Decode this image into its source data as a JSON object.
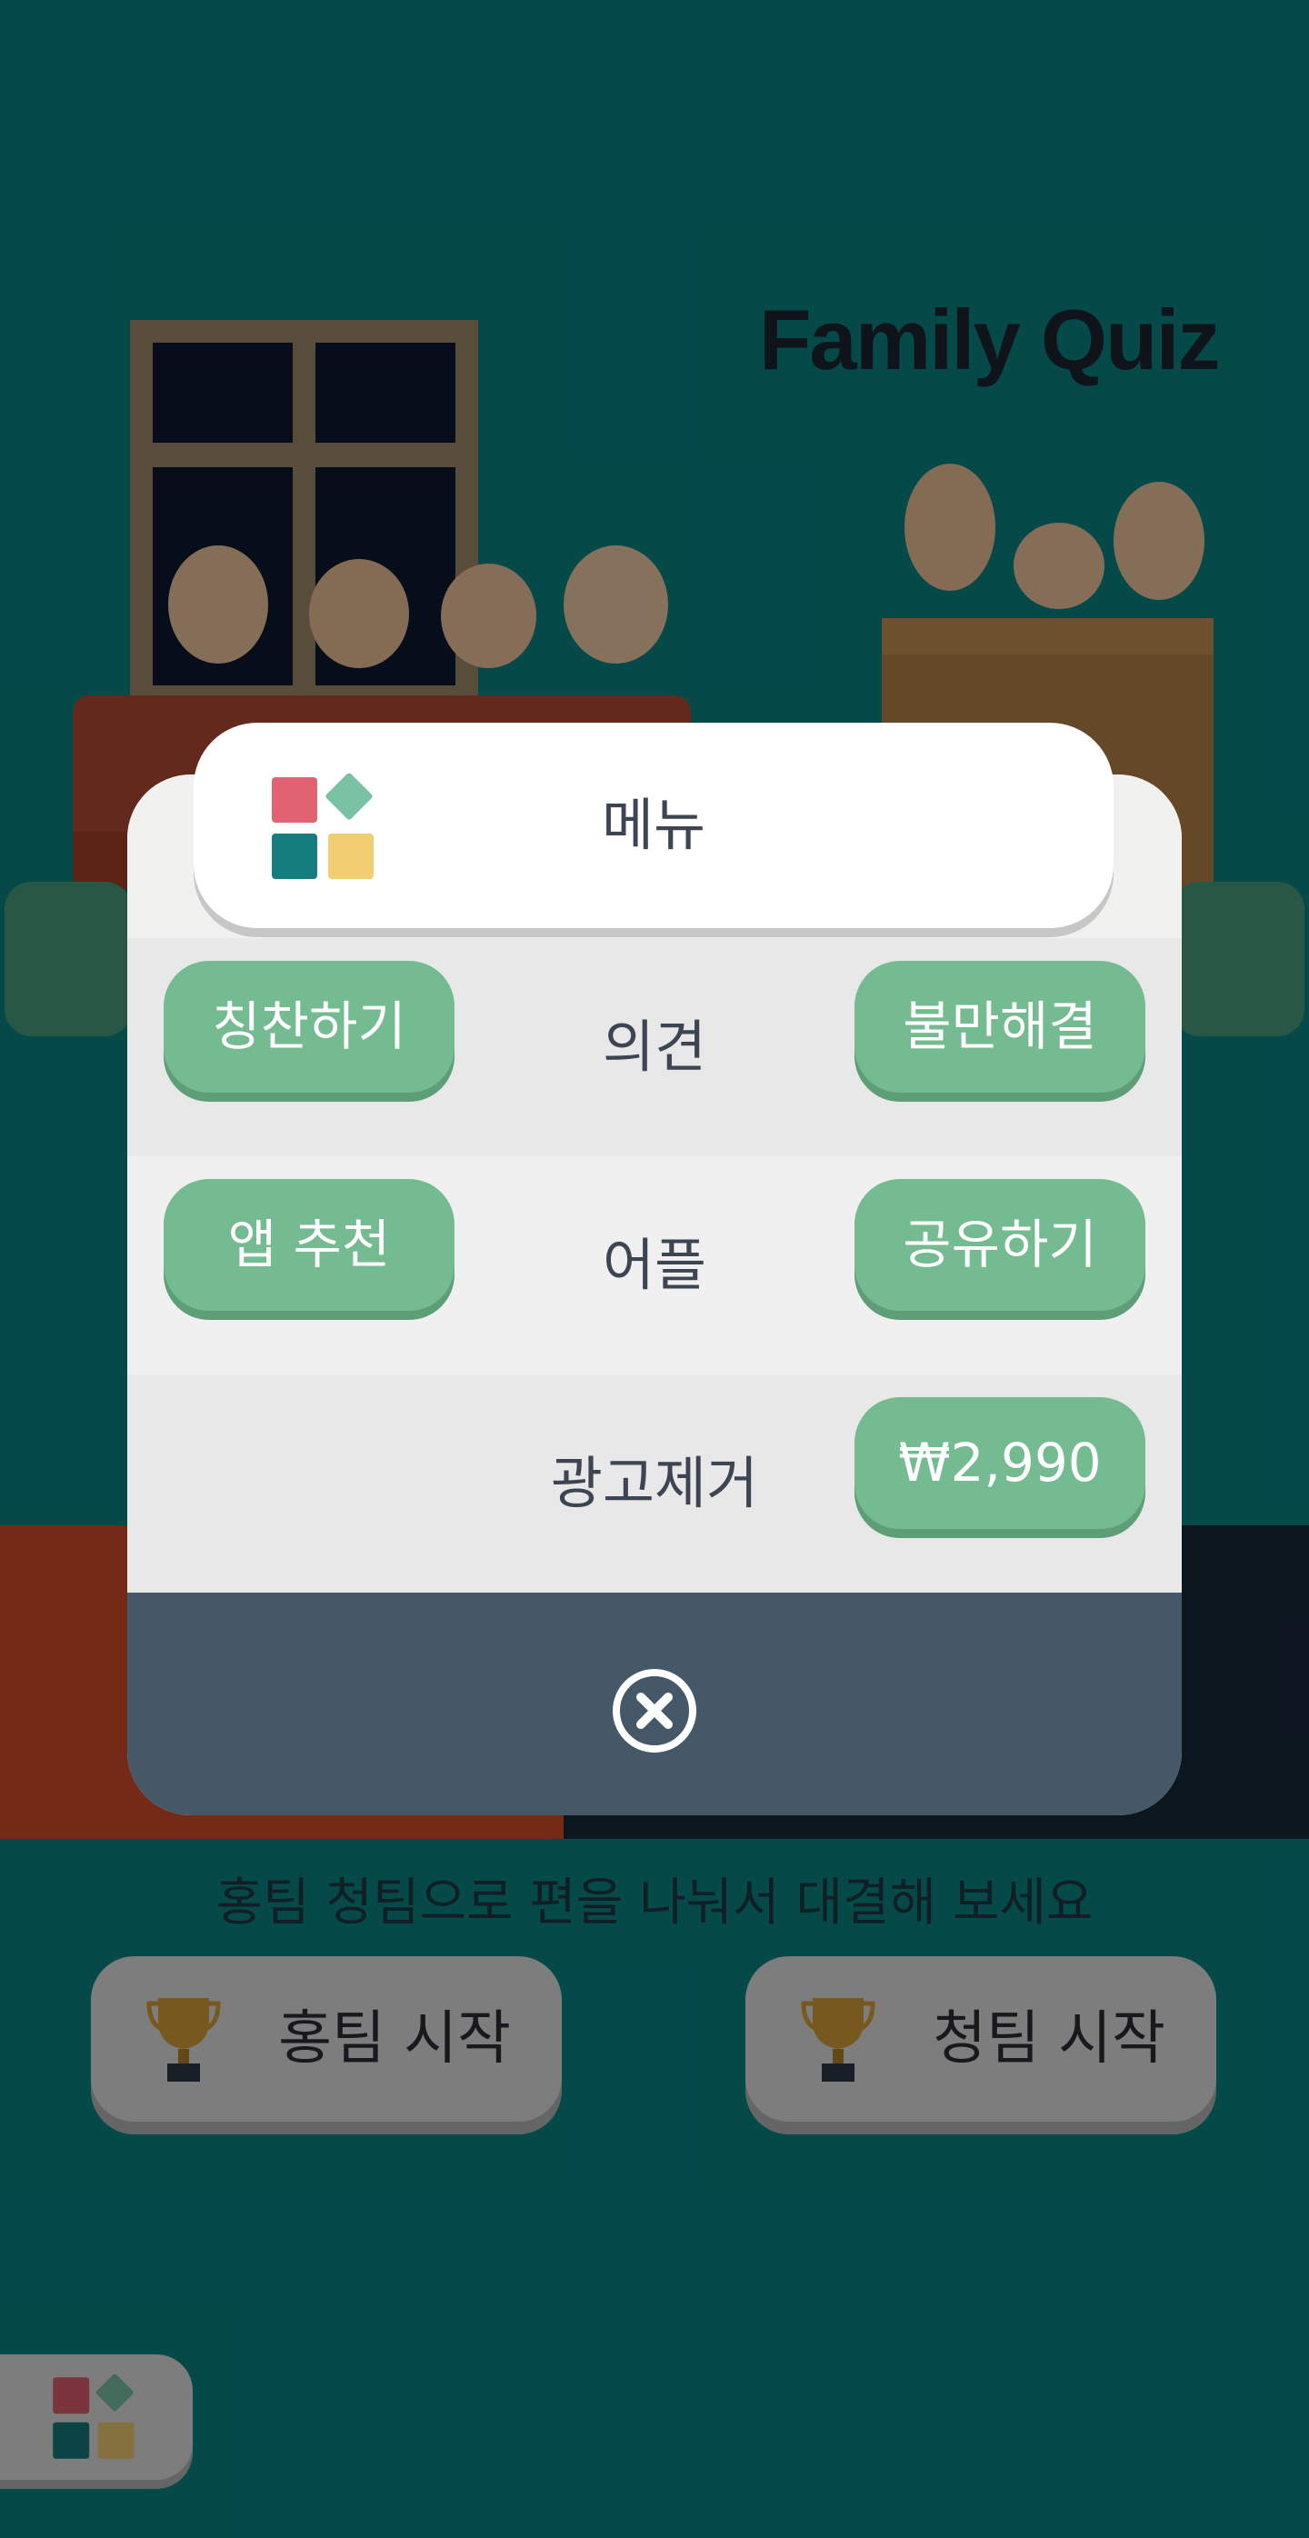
{
  "background": {
    "app_title": "Family Quiz",
    "subtitle": "홍팀 청팀으로 편을 나눠서 대결해 보세요",
    "start_buttons": [
      {
        "label": "홍팀 시작",
        "icon": "trophy-icon"
      },
      {
        "label": "청팀 시작",
        "icon": "trophy-icon"
      }
    ],
    "corner_menu_icon": "menu-grid-icon"
  },
  "dialog": {
    "title": "메뉴",
    "logo_icon": "menu-grid-icon",
    "rows": [
      {
        "label": "의견",
        "left_button": "칭찬하기",
        "right_button": "불만해결"
      },
      {
        "label": "어플",
        "left_button": "앱 추천",
        "right_button": "공유하기"
      },
      {
        "label": "광고제거",
        "right_button": "₩2,990"
      }
    ],
    "close_icon": "close-circle-icon"
  },
  "colors": {
    "accent_green": "#75bb91",
    "footer_slate": "#455868",
    "teal_bg": "#0a8586",
    "logo_red": "#e06270",
    "logo_mint": "#7bc2a4",
    "logo_teal": "#157d7d",
    "logo_yellow": "#f1ce72"
  }
}
